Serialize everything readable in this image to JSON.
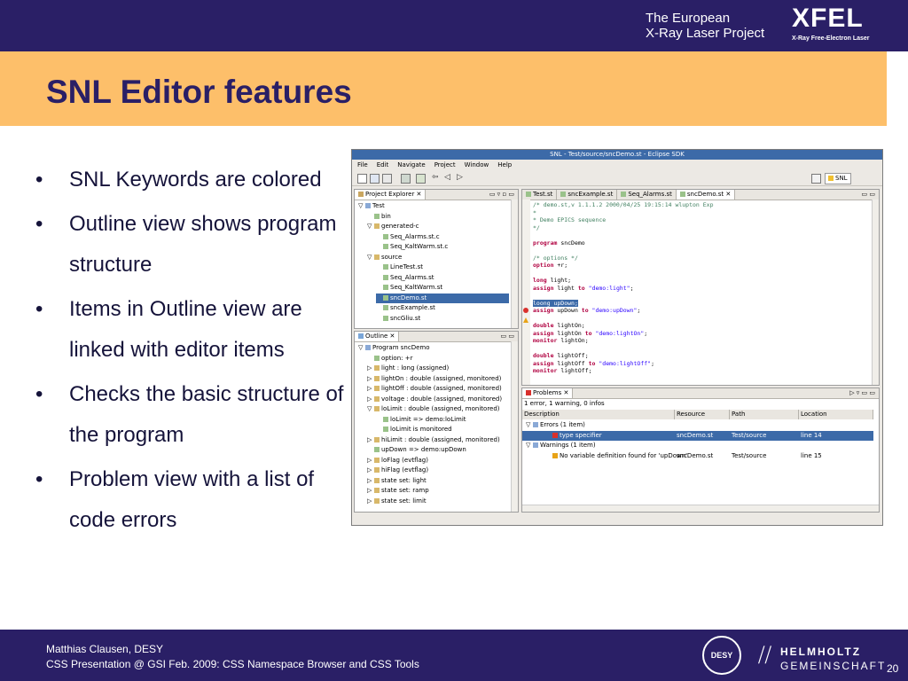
{
  "header": {
    "project_line1": "The European",
    "project_line2": "X-Ray Laser Project",
    "logo_text": "XFEL",
    "logo_sub": "X-Ray Free-Electron Laser"
  },
  "slide": {
    "title": "SNL Editor features",
    "bullets": [
      {
        "text": "SNL Keywords are colored"
      },
      {
        "text": "Outline view shows program structure"
      },
      {
        "text": "Items in Outline view are linked with editor items"
      },
      {
        "text": "Checks the basic structure of the program"
      },
      {
        "text": "Problem view with a list of code errors"
      }
    ],
    "bullet_char": "•"
  },
  "footer": {
    "line1": "Matthias Clausen, DESY",
    "line2": "CSS Presentation @ GSI Feb. 2009: CSS Namespace Browser and CSS Tools",
    "desy_logo": "DESY",
    "helmholtz1": "HELMHOLTZ",
    "helmholtz2": "GEMEINSCHAFT",
    "page_number": "20"
  },
  "eclipse": {
    "window_title": "SNL - Test/source/sncDemo.st - Eclipse SDK",
    "menus": [
      "File",
      "Edit",
      "Navigate",
      "Project",
      "Window",
      "Help"
    ],
    "perspective": "SNL",
    "project_explorer": {
      "title": "Project Explorer",
      "items": [
        {
          "label": "Test",
          "depth": 0,
          "arrow": "▽"
        },
        {
          "label": "bin",
          "depth": 1,
          "arrow": ""
        },
        {
          "label": "generated-c",
          "depth": 1,
          "arrow": "▽"
        },
        {
          "label": "Seq_Alarms.st.c",
          "depth": 2,
          "arrow": ""
        },
        {
          "label": "Seq_KaltWarm.st.c",
          "depth": 2,
          "arrow": ""
        },
        {
          "label": "source",
          "depth": 1,
          "arrow": "▽"
        },
        {
          "label": "LineTest.st",
          "depth": 2,
          "arrow": ""
        },
        {
          "label": "Seq_Alarms.st",
          "depth": 2,
          "arrow": ""
        },
        {
          "label": "Seq_KaltWarm.st",
          "depth": 2,
          "arrow": ""
        },
        {
          "label": "sncDemo.st",
          "depth": 2,
          "arrow": "",
          "selected": true
        },
        {
          "label": "sncExample.st",
          "depth": 2,
          "arrow": ""
        },
        {
          "label": "sncGliu.st",
          "depth": 2,
          "arrow": ""
        }
      ]
    },
    "outline": {
      "title": "Outline",
      "items": [
        {
          "label": "Program sncDemo",
          "depth": 0,
          "arrow": "▽"
        },
        {
          "label": "option: +r",
          "depth": 1,
          "arrow": ""
        },
        {
          "label": "light : long (assigned)",
          "depth": 1,
          "arrow": "▷"
        },
        {
          "label": "lightOn : double (assigned, monitored)",
          "depth": 1,
          "arrow": "▷"
        },
        {
          "label": "lightOff : double (assigned, monitored)",
          "depth": 1,
          "arrow": "▷"
        },
        {
          "label": "voltage : double (assigned, monitored)",
          "depth": 1,
          "arrow": "▷"
        },
        {
          "label": "loLimit : double (assigned, monitored)",
          "depth": 1,
          "arrow": "▽"
        },
        {
          "label": "loLimit => demo:loLimit",
          "depth": 2,
          "arrow": ""
        },
        {
          "label": "loLimit is monitored",
          "depth": 2,
          "arrow": ""
        },
        {
          "label": "hiLimit : double (assigned, monitored)",
          "depth": 1,
          "arrow": "▷"
        },
        {
          "label": "upDown => demo:upDown",
          "depth": 1,
          "arrow": ""
        },
        {
          "label": "loFlag (evtflag)",
          "depth": 1,
          "arrow": "▷"
        },
        {
          "label": "hiFlag (evtflag)",
          "depth": 1,
          "arrow": "▷"
        },
        {
          "label": "state set: light",
          "depth": 1,
          "arrow": "▷"
        },
        {
          "label": "state set: ramp",
          "depth": 1,
          "arrow": "▷"
        },
        {
          "label": "state set: limit",
          "depth": 1,
          "arrow": "▷"
        }
      ]
    },
    "editor": {
      "tabs": [
        "Test.st",
        "sncExample.st",
        "Seq_Alarms.st",
        "sncDemo.st"
      ],
      "active_tab": "sncDemo.st",
      "lines": [
        [
          {
            "t": "/* demo.st,v 1.1.1.2 2000/04/25 19:15:14 wlupton Exp",
            "c": "cm"
          }
        ],
        [
          {
            "t": " *",
            "c": "cm"
          }
        ],
        [
          {
            "t": " * Demo EPICS sequence",
            "c": "cm"
          }
        ],
        [
          {
            "t": " */",
            "c": "cm"
          }
        ],
        [
          {
            "t": "",
            "c": ""
          }
        ],
        [
          {
            "t": "program",
            "c": "kw"
          },
          {
            "t": " sncDemo",
            "c": ""
          }
        ],
        [
          {
            "t": "",
            "c": ""
          }
        ],
        [
          {
            "t": "/* options */",
            "c": "cm"
          }
        ],
        [
          {
            "t": "option",
            "c": "kw"
          },
          {
            "t": "  +r;",
            "c": ""
          }
        ],
        [
          {
            "t": "",
            "c": ""
          }
        ],
        [
          {
            "t": "long",
            "c": "kw"
          },
          {
            "t": "    light;",
            "c": ""
          }
        ],
        [
          {
            "t": "assign",
            "c": "kw"
          },
          {
            "t": "  light    ",
            "c": ""
          },
          {
            "t": "to",
            "c": "kw"
          },
          {
            "t": " ",
            "c": ""
          },
          {
            "t": "\"demo:light\"",
            "c": "str"
          },
          {
            "t": ";",
            "c": ""
          }
        ],
        [
          {
            "t": "",
            "c": ""
          }
        ],
        [
          {
            "t": "loong    upDown;",
            "c": "sel"
          }
        ],
        [
          {
            "t": "assign",
            "c": "kw"
          },
          {
            "t": "  upDown     ",
            "c": ""
          },
          {
            "t": "to",
            "c": "kw"
          },
          {
            "t": " ",
            "c": ""
          },
          {
            "t": "\"demo:upDown\"",
            "c": "str"
          },
          {
            "t": ";",
            "c": ""
          }
        ],
        [
          {
            "t": "",
            "c": ""
          }
        ],
        [
          {
            "t": "double",
            "c": "kw"
          },
          {
            "t": "  lightOn;",
            "c": ""
          }
        ],
        [
          {
            "t": "assign",
            "c": "kw"
          },
          {
            "t": "  lightOn  ",
            "c": ""
          },
          {
            "t": "to",
            "c": "kw"
          },
          {
            "t": " ",
            "c": ""
          },
          {
            "t": "\"demo:lightOn\"",
            "c": "str"
          },
          {
            "t": ";",
            "c": ""
          }
        ],
        [
          {
            "t": "monitor",
            "c": "kw"
          },
          {
            "t": " lightOn;",
            "c": ""
          }
        ],
        [
          {
            "t": "",
            "c": ""
          }
        ],
        [
          {
            "t": "double",
            "c": "kw"
          },
          {
            "t": "  lightOff;",
            "c": ""
          }
        ],
        [
          {
            "t": "assign",
            "c": "kw"
          },
          {
            "t": "  lightOff ",
            "c": ""
          },
          {
            "t": "to",
            "c": "kw"
          },
          {
            "t": " ",
            "c": ""
          },
          {
            "t": "\"demo:lightOff\"",
            "c": "str"
          },
          {
            "t": ";",
            "c": ""
          }
        ],
        [
          {
            "t": "monitor",
            "c": "kw"
          },
          {
            "t": " lightOff;",
            "c": ""
          }
        ]
      ]
    },
    "problems": {
      "title": "Problems",
      "summary": "1 error, 1 warning, 0 infos",
      "columns": [
        "Description",
        "Resource",
        "Path",
        "Location"
      ],
      "rows": [
        {
          "desc": "Errors (1 item)",
          "resource": "",
          "path": "",
          "location": "",
          "kind": "group",
          "arrow": "▽"
        },
        {
          "desc": "type specifier",
          "resource": "sncDemo.st",
          "path": "Test/source",
          "location": "line 14",
          "kind": "error",
          "selected": true
        },
        {
          "desc": "Warnings (1 item)",
          "resource": "",
          "path": "",
          "location": "",
          "kind": "group",
          "arrow": "▽"
        },
        {
          "desc": "No variable definition found for 'upDown'",
          "resource": "sncDemo.st",
          "path": "Test/source",
          "location": "line 15",
          "kind": "warning"
        }
      ]
    },
    "colors": {
      "comment": "#3f7f5f",
      "keyword": "#b00040",
      "string": "#2a00ff",
      "selection": "#3c6aa8",
      "error": "#d9302c",
      "warning": "#e8a317"
    }
  }
}
